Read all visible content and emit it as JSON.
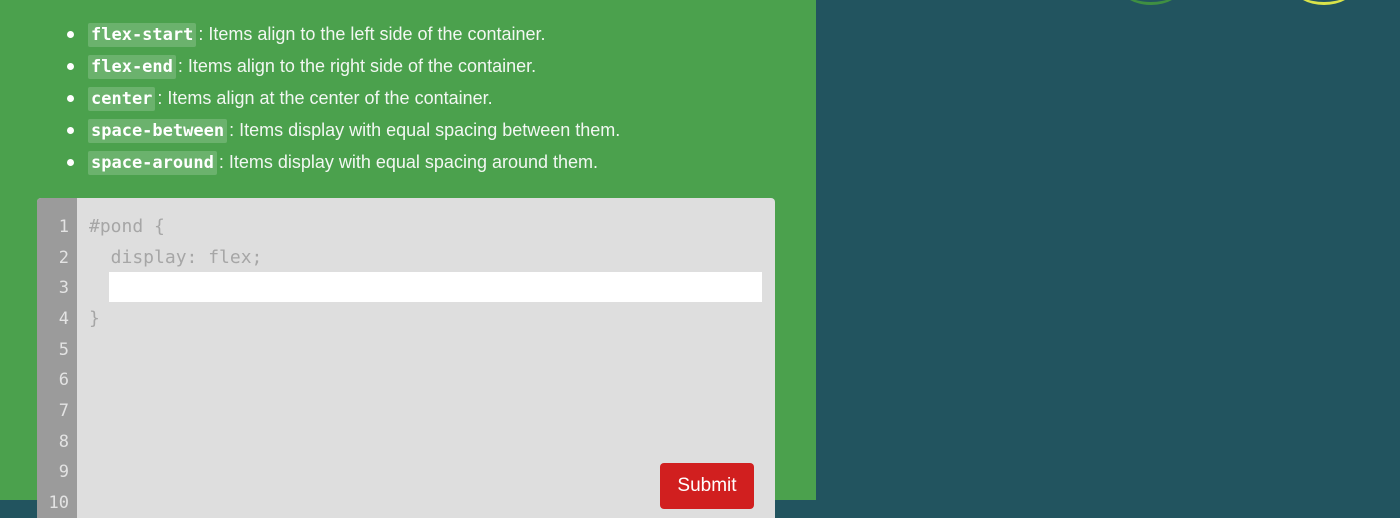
{
  "instructions": {
    "items": [
      {
        "code": "flex-start",
        "text": ": Items align to the left side of the container."
      },
      {
        "code": "flex-end",
        "text": ": Items align to the right side of the container."
      },
      {
        "code": "center",
        "text": ": Items align at the center of the container."
      },
      {
        "code": "space-between",
        "text": ": Items display with equal spacing between them."
      },
      {
        "code": "space-around",
        "text": ": Items display with equal spacing around them."
      }
    ]
  },
  "editor": {
    "line_numbers": [
      "1",
      "2",
      "3",
      "4",
      "5",
      "6",
      "7",
      "8",
      "9",
      "10"
    ],
    "line1": "#pond {",
    "line2": "  display: flex;",
    "line4": "}",
    "input_value": "",
    "submit_label": "Submit"
  },
  "colors": {
    "instructions_bg": "#4ba14d",
    "board_bg": "#22545f",
    "submit_bg": "#d11f1f"
  }
}
